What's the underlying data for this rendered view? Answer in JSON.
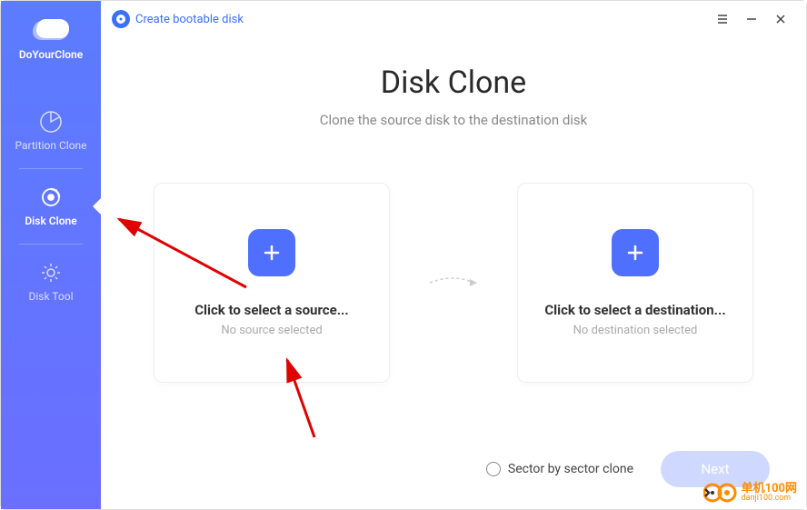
{
  "sidebar": {
    "brand": "DoYourClone",
    "items": [
      {
        "label": "Partition Clone"
      },
      {
        "label": "Disk Clone"
      },
      {
        "label": "Disk Tool"
      }
    ]
  },
  "topbar": {
    "bootable_link": "Create bootable disk"
  },
  "main": {
    "title": "Disk Clone",
    "subtitle": "Clone the source disk to the destination disk",
    "source_card": {
      "title": "Click to select a source...",
      "subtitle": "No source selected"
    },
    "dest_card": {
      "title": "Click to select a destination...",
      "subtitle": "No destination selected"
    }
  },
  "footer": {
    "sector_label": "Sector by sector clone",
    "next_label": "Next"
  },
  "watermark": {
    "cn": "单机100网",
    "url": "danji100.com"
  }
}
